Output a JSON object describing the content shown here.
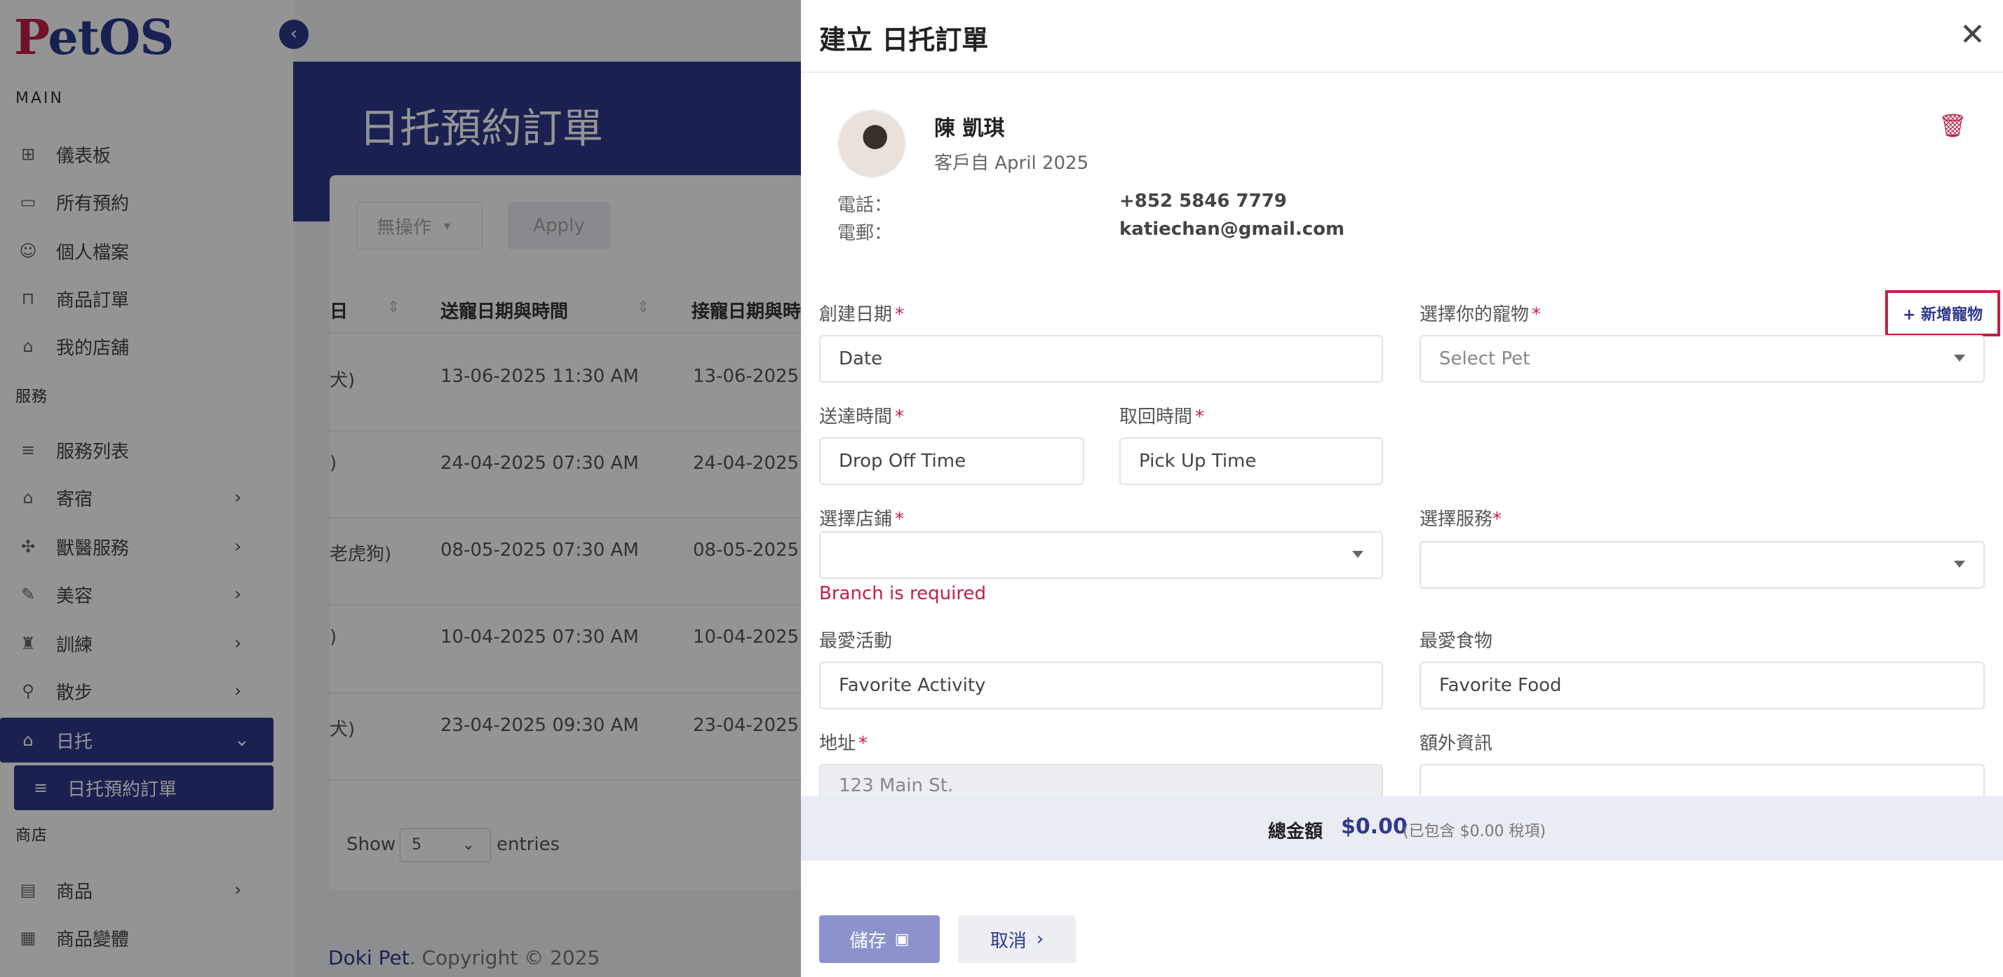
{
  "sidebar": {
    "logo_p": "P",
    "logo_rest": "etOS",
    "sections": {
      "main": "MAIN",
      "services": "服務",
      "shop": "商店"
    },
    "items": [
      {
        "label": "儀表板",
        "icon": "grid-icon"
      },
      {
        "label": "所有預約",
        "icon": "calendar-icon"
      },
      {
        "label": "個人檔案",
        "icon": "user-icon"
      },
      {
        "label": "商品訂單",
        "icon": "bag-icon"
      },
      {
        "label": "我的店舖",
        "icon": "store-icon"
      },
      {
        "label": "服務列表",
        "icon": "list-icon"
      },
      {
        "label": "寄宿",
        "icon": "home-icon"
      },
      {
        "label": "獸醫服務",
        "icon": "vet-icon"
      },
      {
        "label": "美容",
        "icon": "brush-icon"
      },
      {
        "label": "訓練",
        "icon": "training-icon"
      },
      {
        "label": "散步",
        "icon": "walk-icon"
      },
      {
        "label": "日托",
        "icon": "daycare-icon"
      },
      {
        "label": "日托預約訂單",
        "icon": "list-icon"
      },
      {
        "label": "商品",
        "icon": "box-icon"
      },
      {
        "label": "商品變體",
        "icon": "variant-icon"
      }
    ]
  },
  "main": {
    "title": "日托預約訂單",
    "bulk_action": "無操作",
    "apply": "Apply",
    "columns": [
      "日",
      "送寵日期與時間",
      "接寵日期與時"
    ],
    "rows": [
      {
        "pet": "犬)",
        "dropoff": "13-06-2025 11:30 AM",
        "pickup": "13-06-2025"
      },
      {
        "pet": ")",
        "dropoff": "24-04-2025 07:30 AM",
        "pickup": "24-04-2025"
      },
      {
        "pet": "老虎狗)",
        "dropoff": "08-05-2025 07:30 AM",
        "pickup": "08-05-2025"
      },
      {
        "pet": ")",
        "dropoff": "10-04-2025 07:30 AM",
        "pickup": "10-04-2025"
      },
      {
        "pet": "犬)",
        "dropoff": "23-04-2025 09:30 AM",
        "pickup": "23-04-2025"
      }
    ],
    "show": "Show",
    "entries_value": "5",
    "entries": "entries",
    "footer_brand": "Doki Pet",
    "footer_rest": ". Copyright © 2025"
  },
  "drawer": {
    "title": "建立 日托訂單",
    "customer": {
      "name": "陳 凱琪",
      "since": "客戶自 April 2025",
      "phone_label": "電話：",
      "phone": "+852 5846 7779",
      "email_label": "電郵：",
      "email": "katiechan@gmail.com"
    },
    "fields": {
      "created_date": {
        "label": "創建日期",
        "placeholder": "Date"
      },
      "pet": {
        "label": "選擇你的寵物",
        "placeholder": "Select Pet"
      },
      "add_pet": "+ 新增寵物",
      "dropoff": {
        "label": "送達時間",
        "placeholder": "Drop Off Time"
      },
      "pickup": {
        "label": "取回時間",
        "placeholder": "Pick Up Time"
      },
      "branch": {
        "label": "選擇店鋪",
        "error": "Branch is required"
      },
      "service": {
        "label": "選擇服務"
      },
      "activity": {
        "label": "最愛活動",
        "placeholder": "Favorite Activity"
      },
      "food": {
        "label": "最愛食物",
        "placeholder": "Favorite Food"
      },
      "address": {
        "label": "地址",
        "placeholder": "123 Main St."
      },
      "extra": {
        "label": "額外資訊"
      }
    },
    "total": {
      "label": "總金額",
      "value": "$0.00",
      "tax": "(已包含 $0.00 稅項)"
    },
    "save": "儲存",
    "cancel": "取消",
    "required_mark": "*"
  },
  "colors": {
    "primary": "#2e3a8c",
    "accent": "#c21f46"
  }
}
